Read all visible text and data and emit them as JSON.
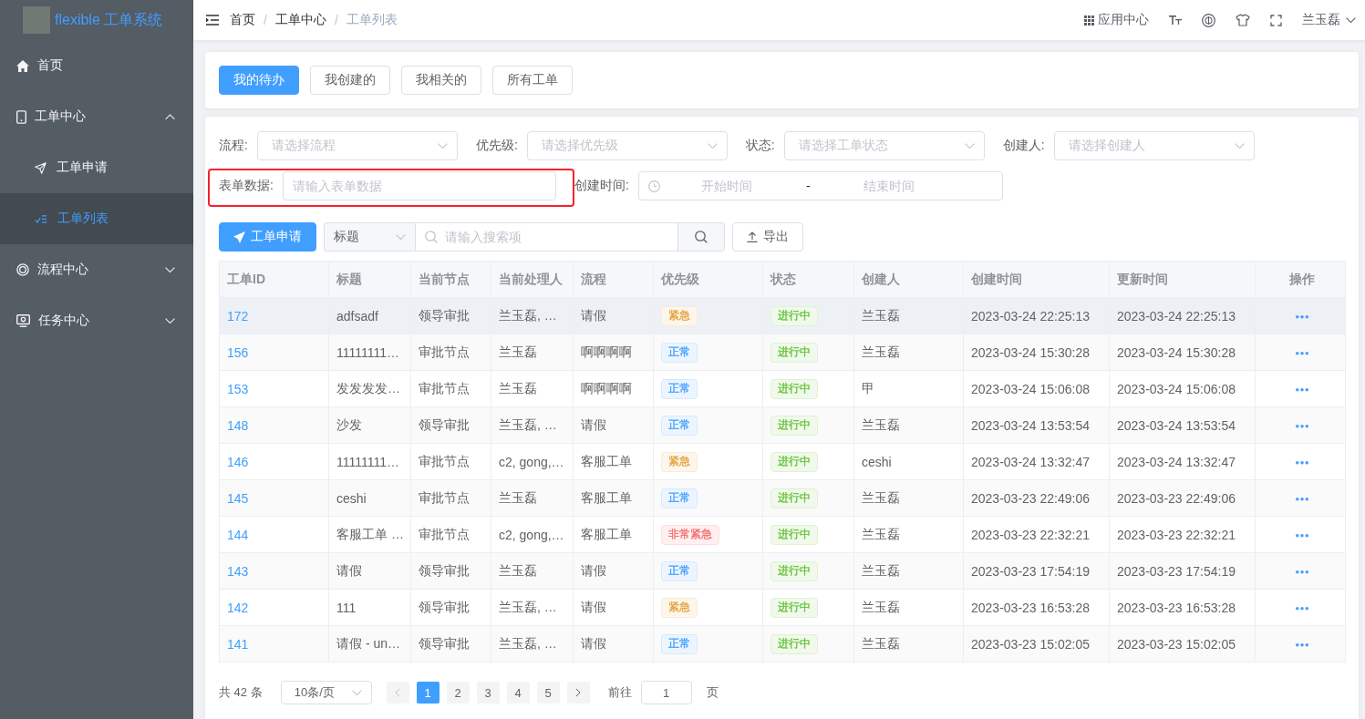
{
  "sidebar": {
    "logo_text": "flexible 工单系统",
    "menu": [
      {
        "label": "首页",
        "kind": "item",
        "selected": false
      },
      {
        "label": "工单中心",
        "kind": "submenu",
        "expanded": true,
        "selected": false,
        "children": [
          {
            "label": "工单申请",
            "selected": false
          },
          {
            "label": "工单列表",
            "selected": true
          }
        ]
      },
      {
        "label": "流程中心",
        "kind": "submenu",
        "expanded": false,
        "selected": false
      },
      {
        "label": "任务中心",
        "kind": "submenu",
        "expanded": false,
        "selected": false
      }
    ]
  },
  "navbar": {
    "breadcrumb": [
      {
        "label": "首页",
        "current": false
      },
      {
        "label": "工单中心",
        "current": false
      },
      {
        "label": "工单列表",
        "current": true
      }
    ],
    "separators": [
      "/",
      "/"
    ],
    "app_center": "应用中心",
    "user": "兰玉磊"
  },
  "tabs": [
    {
      "label": "我的待办",
      "selected": true
    },
    {
      "label": "我创建的",
      "selected": false
    },
    {
      "label": "我相关的",
      "selected": false
    },
    {
      "label": "所有工单",
      "selected": false
    }
  ],
  "filters": [
    {
      "kind": "select",
      "label": "流程:",
      "placeholder": "请选择流程",
      "highlighted": false
    },
    {
      "kind": "select",
      "label": "优先级:",
      "placeholder": "请选择优先级",
      "highlighted": false
    },
    {
      "kind": "select",
      "label": "状态:",
      "placeholder": "请选择工单状态",
      "highlighted": false
    },
    {
      "kind": "select",
      "label": "创建人:",
      "placeholder": "请选择创建人",
      "highlighted": false
    },
    {
      "kind": "input",
      "label": "表单数据:",
      "placeholder": "请输入表单数据",
      "highlighted": true
    },
    {
      "kind": "daterange",
      "label": "创建时间:",
      "start_placeholder": "开始时间",
      "separator": "-",
      "end_placeholder": "结束时间",
      "highlighted": false
    }
  ],
  "toolbar": {
    "create_button": "工单申请",
    "search_category": "标题",
    "search_placeholder": "请输入搜索项",
    "export_button": "导出"
  },
  "table": {
    "columns": [
      "工单ID",
      "标题",
      "当前节点",
      "当前处理人",
      "流程",
      "优先级",
      "状态",
      "创建人",
      "创建时间",
      "更新时间",
      "操作"
    ],
    "rows": [
      {
        "id": "172",
        "title": "adfsadf",
        "node": "领导审批",
        "handler": "兰玉磊, …",
        "flow": "请假",
        "priority": {
          "label": "紧急",
          "color": "#e6a23c"
        },
        "status": {
          "label": "进行中",
          "color": "#67c23a"
        },
        "creator": "兰玉磊",
        "created": "2023-03-24 22:25:13",
        "updated": "2023-03-24 22:25:13",
        "hovered": true
      },
      {
        "id": "156",
        "title": "11111111…",
        "node": "审批节点",
        "handler": "兰玉磊",
        "flow": "啊啊啊啊",
        "priority": {
          "label": "正常",
          "color": "#409eff"
        },
        "status": {
          "label": "进行中",
          "color": "#67c23a"
        },
        "creator": "兰玉磊",
        "created": "2023-03-24 15:30:28",
        "updated": "2023-03-24 15:30:28",
        "hovered": false
      },
      {
        "id": "153",
        "title": "发发发发…",
        "node": "审批节点",
        "handler": "兰玉磊",
        "flow": "啊啊啊啊",
        "priority": {
          "label": "正常",
          "color": "#409eff"
        },
        "status": {
          "label": "进行中",
          "color": "#67c23a"
        },
        "creator": "甲",
        "created": "2023-03-24 15:06:08",
        "updated": "2023-03-24 15:06:08",
        "hovered": false
      },
      {
        "id": "148",
        "title": "沙发",
        "node": "领导审批",
        "handler": "兰玉磊, …",
        "flow": "请假",
        "priority": {
          "label": "正常",
          "color": "#409eff"
        },
        "status": {
          "label": "进行中",
          "color": "#67c23a"
        },
        "creator": "兰玉磊",
        "created": "2023-03-24 13:53:54",
        "updated": "2023-03-24 13:53:54",
        "hovered": false
      },
      {
        "id": "146",
        "title": "11111111…",
        "node": "审批节点",
        "handler": "c2, gong,…",
        "flow": "客服工单",
        "priority": {
          "label": "紧急",
          "color": "#e6a23c"
        },
        "status": {
          "label": "进行中",
          "color": "#67c23a"
        },
        "creator": "ceshi",
        "created": "2023-03-24 13:32:47",
        "updated": "2023-03-24 13:32:47",
        "hovered": false
      },
      {
        "id": "145",
        "title": "ceshi",
        "node": "审批节点",
        "handler": "兰玉磊",
        "flow": "客服工单",
        "priority": {
          "label": "正常",
          "color": "#409eff"
        },
        "status": {
          "label": "进行中",
          "color": "#67c23a"
        },
        "creator": "兰玉磊",
        "created": "2023-03-23 22:49:06",
        "updated": "2023-03-23 22:49:06",
        "hovered": false
      },
      {
        "id": "144",
        "title": "客服工单 …",
        "node": "审批节点",
        "handler": "c2, gong,…",
        "flow": "客服工单",
        "priority": {
          "label": "非常紧急",
          "color": "#f56c6c"
        },
        "status": {
          "label": "进行中",
          "color": "#67c23a"
        },
        "creator": "兰玉磊",
        "created": "2023-03-23 22:32:21",
        "updated": "2023-03-23 22:32:21",
        "hovered": false
      },
      {
        "id": "143",
        "title": "请假",
        "node": "领导审批",
        "handler": "兰玉磊",
        "flow": "请假",
        "priority": {
          "label": "正常",
          "color": "#409eff"
        },
        "status": {
          "label": "进行中",
          "color": "#67c23a"
        },
        "creator": "兰玉磊",
        "created": "2023-03-23 17:54:19",
        "updated": "2023-03-23 17:54:19",
        "hovered": false
      },
      {
        "id": "142",
        "title": "111",
        "node": "领导审批",
        "handler": "兰玉磊, …",
        "flow": "请假",
        "priority": {
          "label": "紧急",
          "color": "#e6a23c"
        },
        "status": {
          "label": "进行中",
          "color": "#67c23a"
        },
        "creator": "兰玉磊",
        "created": "2023-03-23 16:53:28",
        "updated": "2023-03-23 16:53:28",
        "hovered": false
      },
      {
        "id": "141",
        "title": "请假 - un…",
        "node": "领导审批",
        "handler": "兰玉磊, …",
        "flow": "请假",
        "priority": {
          "label": "正常",
          "color": "#409eff"
        },
        "status": {
          "label": "进行中",
          "color": "#67c23a"
        },
        "creator": "兰玉磊",
        "created": "2023-03-23 15:02:05",
        "updated": "2023-03-23 15:02:05",
        "hovered": false
      }
    ]
  },
  "pagination": {
    "total": "共 42 条",
    "page_size": "10条/页",
    "prev": {
      "disabled": true
    },
    "pages": [
      {
        "label": "1",
        "selected": true
      },
      {
        "label": "2",
        "selected": false
      },
      {
        "label": "3",
        "selected": false
      },
      {
        "label": "4",
        "selected": false
      },
      {
        "label": "5",
        "selected": false
      }
    ],
    "next": {
      "disabled": false
    },
    "goto_label": "前往",
    "goto_value": "1",
    "page_suffix": "页"
  }
}
